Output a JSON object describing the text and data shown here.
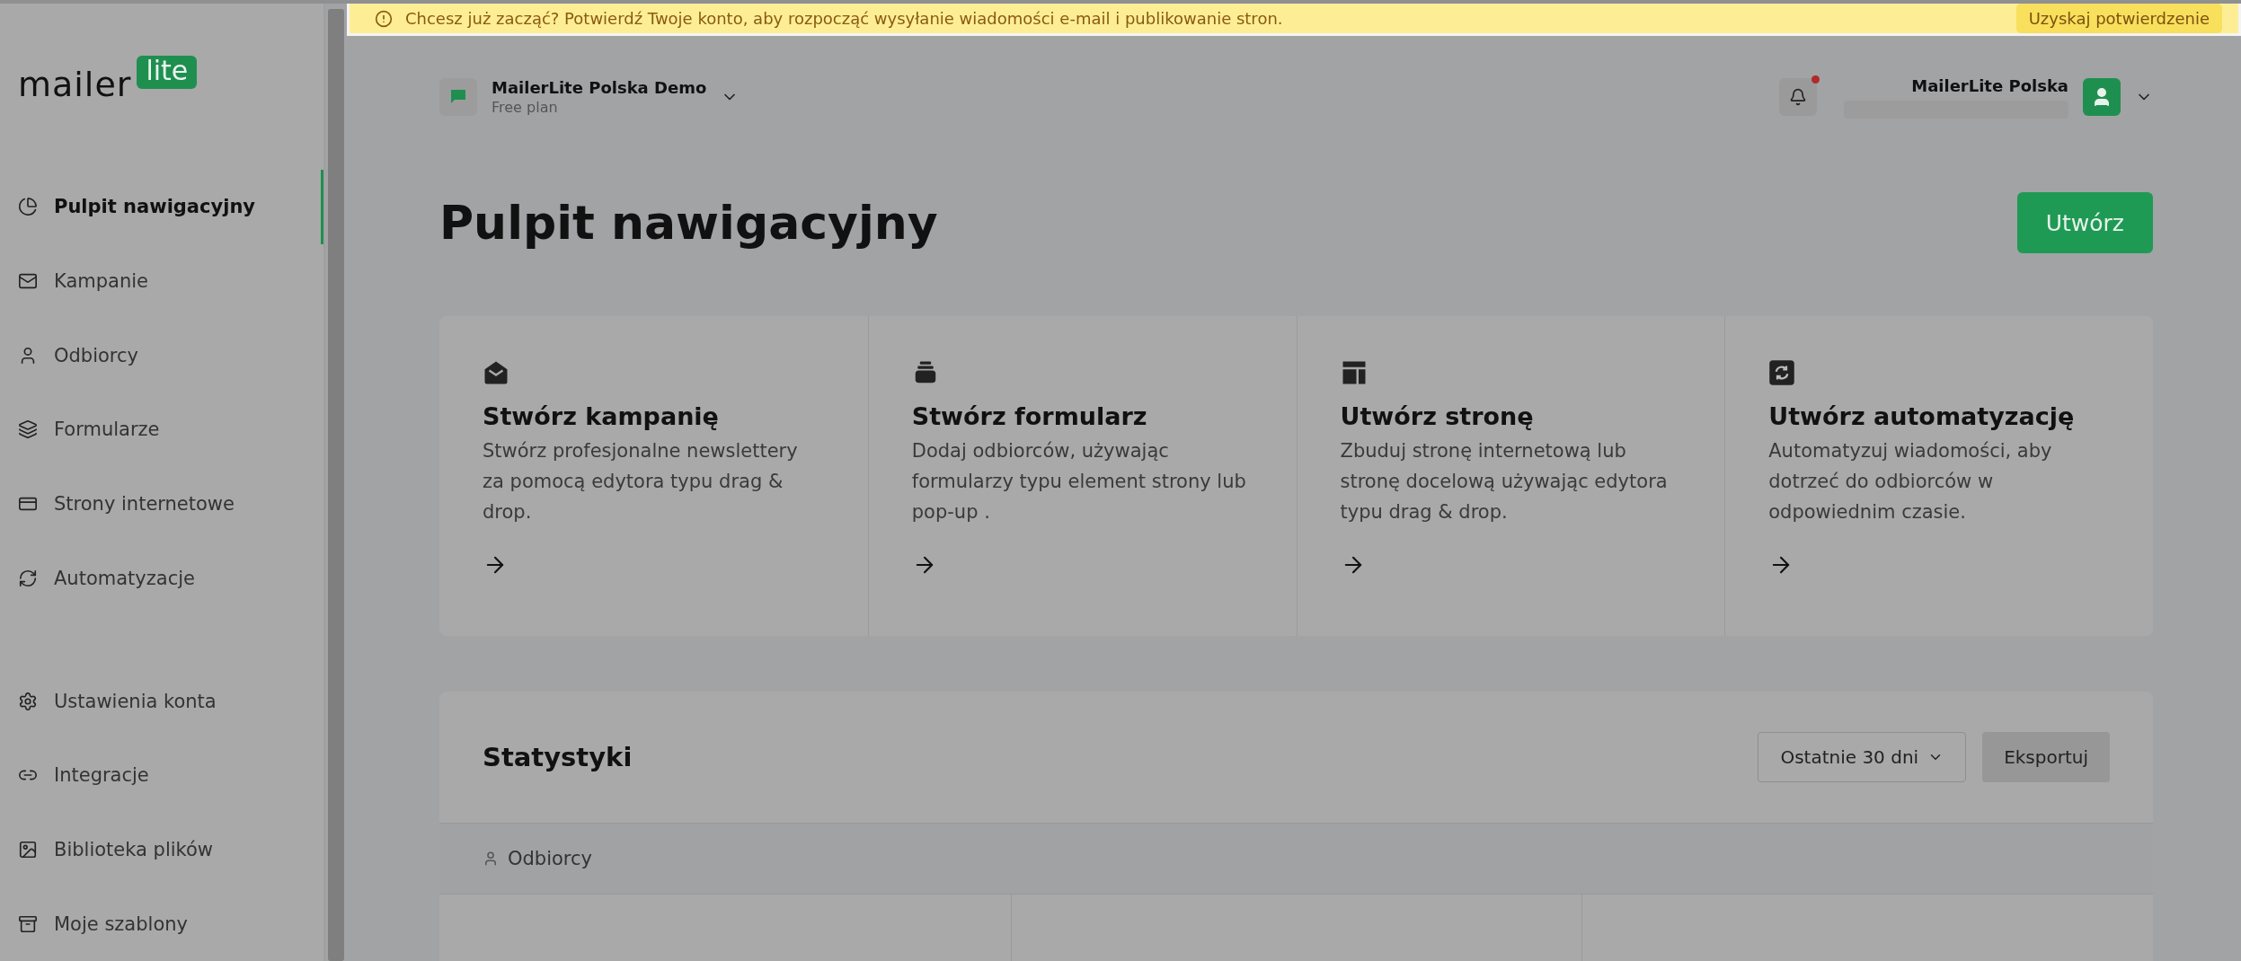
{
  "banner": {
    "message": "Chcesz już zacząć? Potwierdź Twoje konto, aby rozpocząć wysyłanie wiadomości e-mail i publikowanie stron.",
    "action": "Uzyskaj potwierdzenie"
  },
  "logo": {
    "word": "mailer",
    "badge": "lite"
  },
  "sidebar": {
    "items": [
      {
        "label": "Pulpit nawigacyjny",
        "selected": true
      },
      {
        "label": "Kampanie",
        "selected": false
      },
      {
        "label": "Odbiorcy",
        "selected": false
      },
      {
        "label": "Formularze",
        "selected": false
      },
      {
        "label": "Strony internetowe",
        "selected": false
      },
      {
        "label": "Automatyzacje",
        "selected": false
      }
    ],
    "bottom_items": [
      {
        "label": "Ustawienia konta",
        "selected": false
      },
      {
        "label": "Integracje",
        "selected": false
      },
      {
        "label": "Biblioteka plików",
        "selected": false
      },
      {
        "label": "Moje szablony",
        "selected": false
      }
    ]
  },
  "account": {
    "name": "MailerLite Polska Demo",
    "plan": "Free plan"
  },
  "notifications": {
    "unread": true
  },
  "user": {
    "name": "MailerLite Polska"
  },
  "page": {
    "title": "Pulpit nawigacyjny",
    "create_button": "Utwórz"
  },
  "cards": [
    {
      "title": "Stwórz kampanię",
      "text": "Stwórz profesjonalne newslettery za pomocą edytora typu drag & drop."
    },
    {
      "title": "Stwórz formularz",
      "text": "Dodaj odbiorców, używając formularzy typu element strony lub pop-up ."
    },
    {
      "title": "Utwórz stronę",
      "text": "Zbuduj stronę internetową lub stronę docelową używając edytora typu drag & drop."
    },
    {
      "title": "Utwórz automatyzację",
      "text": "Automatyzuj wiadomości, aby dotrzeć do odbiorców w odpowiednim czasie."
    }
  ],
  "stats": {
    "title": "Statystyki",
    "period": "Ostatnie 30 dni",
    "export": "Eksportuj",
    "tab": "Odbiorcy"
  }
}
